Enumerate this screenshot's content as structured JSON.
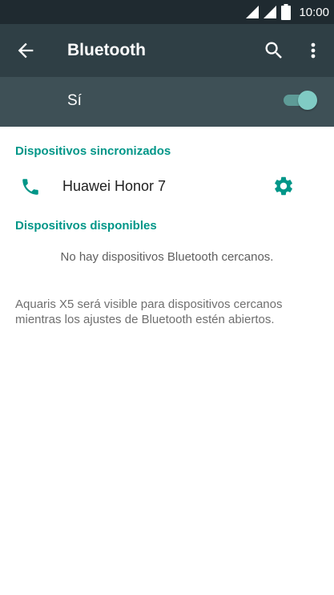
{
  "status_bar": {
    "time": "10:00",
    "icons": [
      "signal-icon",
      "signal-icon",
      "battery-icon"
    ]
  },
  "toolbar": {
    "back_icon": "arrow-back-icon",
    "title": "Bluetooth",
    "search_icon": "search-icon",
    "more_icon": "more-vert-icon"
  },
  "bluetooth_switch": {
    "label": "Sí",
    "state": "on",
    "accent_color": "#80cbc4"
  },
  "paired_section": {
    "header": "Dispositivos sincronizados",
    "devices": [
      {
        "name": "Huawei Honor 7",
        "icon": "phone-icon",
        "settings_icon": "gear-icon"
      }
    ]
  },
  "available_section": {
    "header": "Dispositivos disponibles",
    "empty_message": "No hay dispositivos Bluetooth cercanos."
  },
  "footer": {
    "visibility_text": "Aquaris X5 será visible para dispositivos cercanos mientras los ajustes de Bluetooth estén abiertos."
  },
  "colors": {
    "status_bar": "#1f2a30",
    "toolbar": "#2f3f45",
    "switch_bar": "#3e5056",
    "accent": "#009688"
  }
}
